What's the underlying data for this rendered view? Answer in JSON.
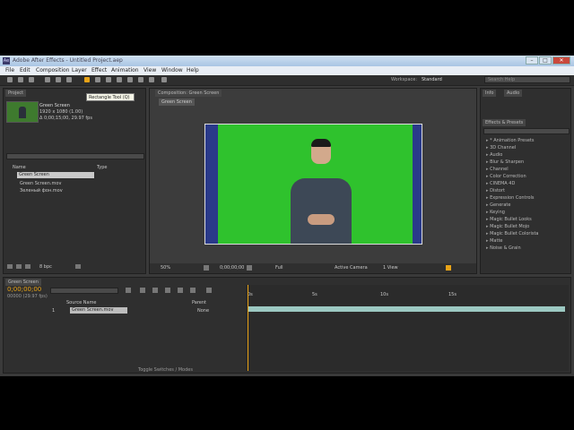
{
  "window": {
    "title": "Adobe After Effects - Untitled Project.aep"
  },
  "menu": [
    "File",
    "Edit",
    "Composition",
    "Layer",
    "Effect",
    "Animation",
    "View",
    "Window",
    "Help"
  ],
  "toolbar": {
    "tooltip": "Rectangle Tool (Q)",
    "workspace_label": "Workspace:",
    "workspace_value": "Standard",
    "search_placeholder": "Search Help"
  },
  "project": {
    "tab": "Project",
    "item_name": "Green Screen",
    "item_meta1": "1920 x 1080 (1.00)",
    "item_meta2": "Δ 0;00;15;00, 29.97 fps",
    "col_name": "Name",
    "col_type": "Type",
    "items": [
      "Green Screen",
      "Green Screen.mov",
      "Зеленый фон.mov"
    ],
    "bpc": "8 bpc"
  },
  "composition": {
    "tab": "Composition: Green Screen",
    "subtab": "Green Screen",
    "zoom": "50%",
    "timecode": "0;00;00;00",
    "quality": "Full",
    "camera": "Active Camera",
    "views": "1 View"
  },
  "effects": {
    "tabs": [
      "Info",
      "Audio"
    ],
    "panel": "Effects & Presets",
    "list": [
      "* Animation Presets",
      "3D Channel",
      "Audio",
      "Blur & Sharpen",
      "Channel",
      "Color Correction",
      "CINEMA 4D",
      "Distort",
      "Expression Controls",
      "Generate",
      "Keying",
      "Magic Bullet Looks",
      "Magic Bullet Mojo",
      "Magic Bullet Colorista",
      "Matte",
      "Noise & Grain"
    ]
  },
  "timeline": {
    "tab": "Green Screen",
    "timecode": "0;00;00;00",
    "timecode_sub": "00000 (29.97 fps)",
    "search_placeholder": "",
    "col_source": "Source Name",
    "col_parent": "Parent",
    "layer_num": "1",
    "layer_name": "Green Screen.mov",
    "parent_value": "None",
    "ticks": [
      "0s",
      "5s",
      "10s",
      "15s"
    ],
    "footer": "Toggle Switches / Modes"
  },
  "colors": {
    "accent": "#e8a317",
    "green_screen": "#2fc22d"
  }
}
